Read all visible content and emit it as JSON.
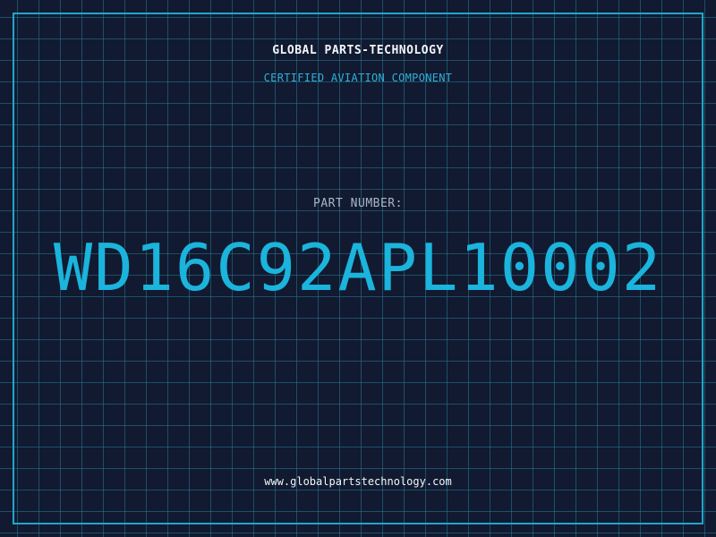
{
  "header": {
    "company": "GLOBAL PARTS-TECHNOLOGY",
    "tagline": "CERTIFIED AVIATION COMPONENT"
  },
  "part": {
    "label": "PART NUMBER:",
    "number": "WD16C92APL10002"
  },
  "footer": {
    "website": "www.globalpartstechnology.com"
  },
  "colors": {
    "background": "#111a30",
    "grid": "#28788f",
    "accent": "#22a6cc",
    "part_number": "#1bb4dc",
    "text_light": "#f2f6fa",
    "text_muted": "#a7b6c6"
  }
}
